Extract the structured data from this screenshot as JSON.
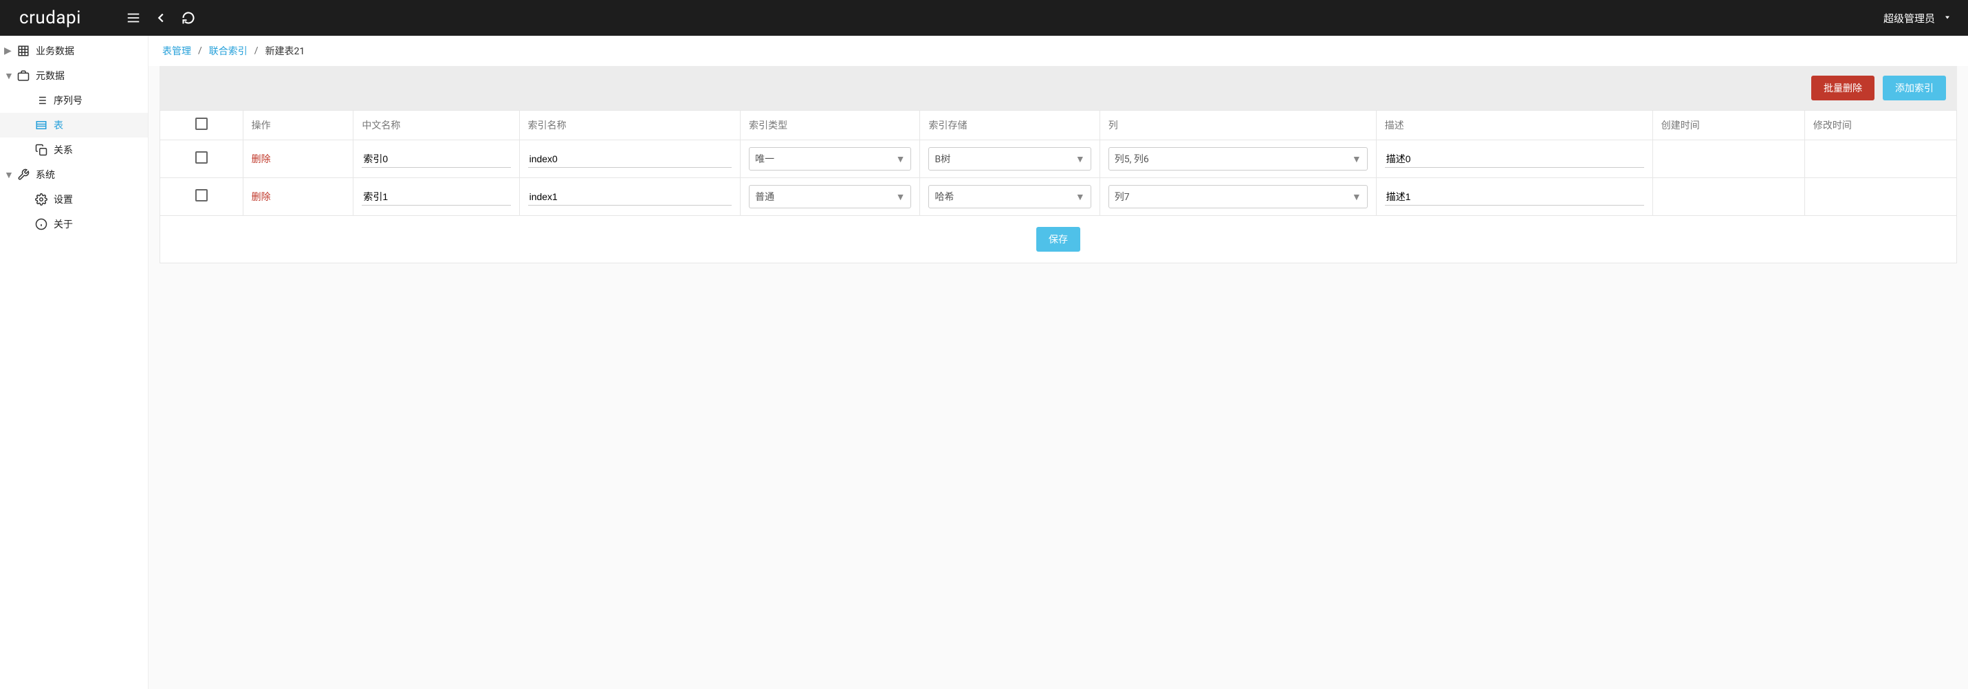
{
  "header": {
    "logo": "crudapi",
    "user_label": "超级管理员"
  },
  "sidebar": {
    "business_data": "业务数据",
    "metadata": "元数据",
    "sequence": "序列号",
    "table": "表",
    "relation": "关系",
    "system": "系统",
    "settings": "设置",
    "about": "关于"
  },
  "breadcrumb": {
    "table_management": "表管理",
    "composite_index": "联合索引",
    "current": "新建表21"
  },
  "toolbar": {
    "batch_delete": "批量删除",
    "add_index": "添加索引"
  },
  "columns": {
    "operation": "操作",
    "cn_name": "中文名称",
    "index_name": "索引名称",
    "index_type": "索引类型",
    "index_storage": "索引存储",
    "cols": "列",
    "desc": "描述",
    "created": "创建时间",
    "modified": "修改时间"
  },
  "rows": [
    {
      "delete": "删除",
      "cn_name": "索引0",
      "index_name": "index0",
      "index_type": "唯一",
      "index_storage": "B树",
      "cols": "列5, 列6",
      "desc": "描述0",
      "created": "",
      "modified": ""
    },
    {
      "delete": "删除",
      "cn_name": "索引1",
      "index_name": "index1",
      "index_type": "普通",
      "index_storage": "哈希",
      "cols": "列7",
      "desc": "描述1",
      "created": "",
      "modified": ""
    }
  ],
  "footer": {
    "save": "保存"
  }
}
